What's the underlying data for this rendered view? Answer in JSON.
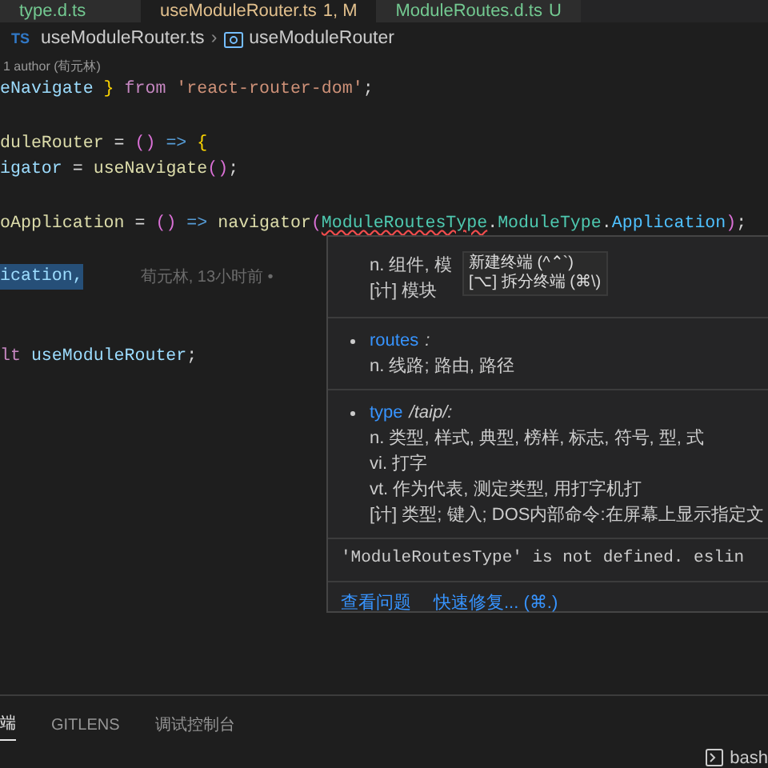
{
  "tabs": [
    {
      "label": "type.d.ts",
      "selected": false,
      "modified": false
    },
    {
      "label": "useModuleRouter.ts",
      "badge": "1, M",
      "selected": true,
      "modified": true
    },
    {
      "label": "ModuleRoutes.d.ts",
      "badge": "U",
      "selected": false,
      "modified": false
    }
  ],
  "breadcrumb": {
    "icon": "TS",
    "file": "useModuleRouter.ts",
    "separator": "›",
    "symbol": "useModuleRouter"
  },
  "codelens": "1 author (荀元林)",
  "code_lines": [
    {
      "kind": "code",
      "selected": false,
      "tokens": [
        {
          "text": "eNavigate",
          "kind": "var"
        },
        {
          "text": " } ",
          "kind": "bracket"
        },
        {
          "text": "from",
          "kind": "keyword"
        },
        {
          "text": " 'react-router-dom'",
          "kind": "string"
        },
        {
          "text": ";",
          "kind": "punct"
        }
      ]
    },
    {
      "kind": "blank"
    },
    {
      "kind": "code",
      "selected": false,
      "tokens": [
        {
          "text": "duleRouter",
          "kind": "func"
        },
        {
          "text": " = ",
          "kind": "punct"
        },
        {
          "text": "()",
          "kind": "bracket2"
        },
        {
          "text": " => ",
          "kind": "arrow"
        },
        {
          "text": "{",
          "kind": "bracket"
        }
      ]
    },
    {
      "kind": "code",
      "selected": false,
      "tokens": [
        {
          "text": "igator",
          "kind": "var"
        },
        {
          "text": " = ",
          "kind": "punct"
        },
        {
          "text": "useNavigate",
          "kind": "func"
        },
        {
          "text": "()",
          "kind": "bracket2"
        },
        {
          "text": ";",
          "kind": "punct"
        }
      ]
    },
    {
      "kind": "blank"
    },
    {
      "kind": "code",
      "selected": false,
      "tokens": [
        {
          "text": "oApplication",
          "kind": "func"
        },
        {
          "text": " = ",
          "kind": "punct"
        },
        {
          "text": "()",
          "kind": "bracket2"
        },
        {
          "text": " => ",
          "kind": "arrow"
        },
        {
          "text": "navigator",
          "kind": "func"
        },
        {
          "text": "(",
          "kind": "bracket2"
        },
        {
          "text": "ModuleRoutesType",
          "kind": "type",
          "error": true
        },
        {
          "text": ".",
          "kind": "punct"
        },
        {
          "text": "ModuleType",
          "kind": "type"
        },
        {
          "text": ".",
          "kind": "punct"
        },
        {
          "text": "Application",
          "kind": "member"
        },
        {
          "text": ")",
          "kind": "bracket2"
        },
        {
          "text": ";",
          "kind": "punct"
        }
      ]
    },
    {
      "kind": "blank"
    },
    {
      "kind": "code",
      "tokens": [
        {
          "text": "ication,",
          "kind": "var"
        }
      ],
      "selected": true,
      "blame": "荀元林, 13小时前 •"
    },
    {
      "kind": "blank"
    },
    {
      "kind": "blank"
    },
    {
      "kind": "code",
      "selected": false,
      "tokens": [
        {
          "text": "lt",
          "kind": "keyword"
        },
        {
          "text": " useModuleRouter",
          "kind": "var"
        },
        {
          "text": ";",
          "kind": "punct"
        }
      ]
    }
  ],
  "hover": {
    "sections": [
      {
        "lines": [
          "n. 组件, 模",
          "[计] 模块"
        ]
      },
      {
        "word": "routes",
        "phonetic": ":",
        "lines": [
          "n. 线路; 路由, 路径"
        ]
      },
      {
        "word": "type",
        "phonetic": "/taip/:",
        "lines": [
          "n. 类型, 样式, 典型, 榜样, 标志, 符号, 型, 式",
          "vi. 打字",
          "vt. 作为代表, 测定类型, 用打字机打",
          "[计] 类型; 键入; DOS内部命令:在屏幕上显示指定文"
        ]
      }
    ],
    "error": "'ModuleRoutesType' is not defined. eslin",
    "actions": [
      "查看问题",
      "快速修复... (⌘.)"
    ]
  },
  "tooltip": [
    "新建终端 (^⌃`)",
    "[⌥] 拆分终端 (⌘\\)"
  ],
  "panel_tabs": [
    {
      "label": "端",
      "selected": true
    },
    {
      "label": "GITLENS",
      "selected": false
    },
    {
      "label": "调试控制台",
      "selected": false
    }
  ],
  "shell": "bash"
}
